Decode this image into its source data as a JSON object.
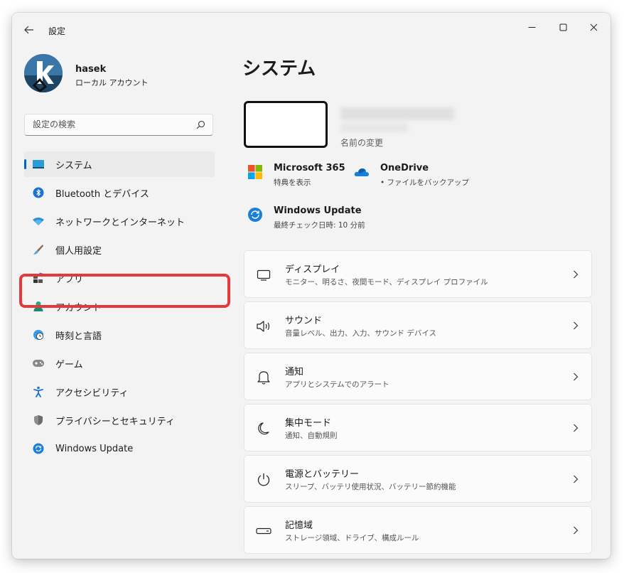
{
  "window": {
    "title": "設定"
  },
  "profile": {
    "name": "hasek",
    "account_type": "ローカル アカウント"
  },
  "search": {
    "placeholder": "設定の検索"
  },
  "nav": {
    "items": [
      {
        "label": "システム",
        "icon": "system-display-icon",
        "active": true
      },
      {
        "label": "Bluetooth とデバイス",
        "icon": "bluetooth-icon"
      },
      {
        "label": "ネットワークとインターネット",
        "icon": "wifi-icon"
      },
      {
        "label": "個人用設定",
        "icon": "brush-icon"
      },
      {
        "label": "アプリ",
        "icon": "apps-icon"
      },
      {
        "label": "アカウント",
        "icon": "person-icon"
      },
      {
        "label": "時刻と言語",
        "icon": "globe-clock-icon"
      },
      {
        "label": "ゲーム",
        "icon": "gamepad-icon"
      },
      {
        "label": "アクセシビリティ",
        "icon": "accessibility-icon"
      },
      {
        "label": "プライバシーとセキュリティ",
        "icon": "shield-icon"
      },
      {
        "label": "Windows Update",
        "icon": "windows-update-icon"
      }
    ]
  },
  "main": {
    "title": "システム",
    "rename_label": "名前の変更",
    "quick": [
      {
        "title": "Microsoft 365",
        "sub": "特典を表示",
        "icon": "microsoft-logo-icon"
      },
      {
        "title": "OneDrive",
        "sub": "• ファイルをバックアップ",
        "icon": "onedrive-cloud-icon"
      },
      {
        "title": "Windows Update",
        "sub": "最終チェック日時: 10 分前",
        "icon": "windows-update-icon"
      }
    ],
    "cards": [
      {
        "title": "ディスプレイ",
        "sub": "モニター、明るさ、夜間モード、ディスプレイ プロファイル",
        "icon": "monitor-icon"
      },
      {
        "title": "サウンド",
        "sub": "音量レベル、出力、入力、サウンド デバイス",
        "icon": "speaker-icon"
      },
      {
        "title": "通知",
        "sub": "アプリとシステムでのアラート",
        "icon": "bell-icon"
      },
      {
        "title": "集中モード",
        "sub": "通知、自動規則",
        "icon": "moon-icon"
      },
      {
        "title": "電源とバッテリー",
        "sub": "スリープ、バッテリ使用状況、バッテリー節約機能",
        "icon": "power-icon"
      },
      {
        "title": "記憶域",
        "sub": "ストレージ領域、ドライブ、構成ルール",
        "icon": "storage-drive-icon"
      }
    ]
  },
  "colors": {
    "accent": "#0067c0",
    "highlight": "#e4383b"
  }
}
